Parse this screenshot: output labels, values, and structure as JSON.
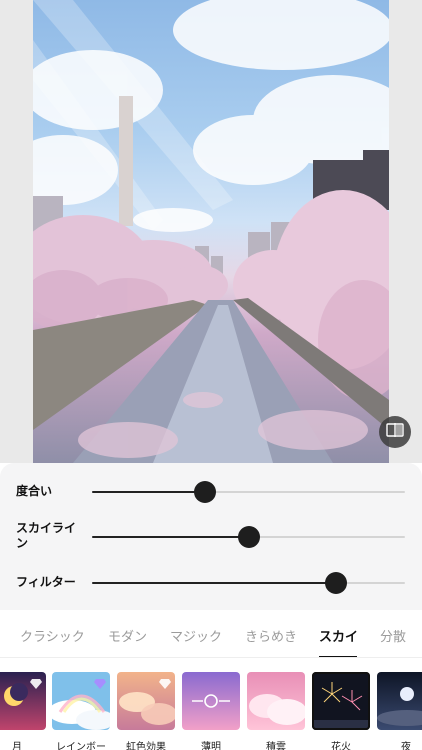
{
  "adjustments": [
    {
      "label": "度合い",
      "value": 0.36
    },
    {
      "label": "スカイライン",
      "value": 0.5
    },
    {
      "label": "フィルター",
      "value": 0.78
    }
  ],
  "tabs": [
    {
      "label": "クラシック"
    },
    {
      "label": "モダン"
    },
    {
      "label": "マジック"
    },
    {
      "label": "きらめき"
    },
    {
      "label": "スカイ"
    },
    {
      "label": "分散"
    }
  ],
  "active_tab": "スカイ",
  "filters": [
    {
      "label": "月",
      "premium": true
    },
    {
      "label": "レインボー",
      "premium": true
    },
    {
      "label": "虹色効果",
      "premium": true
    },
    {
      "label": "薄明",
      "premium": false
    },
    {
      "label": "積雲",
      "premium": false
    },
    {
      "label": "花火",
      "premium": false
    },
    {
      "label": "夜",
      "premium": false
    }
  ],
  "colors": {
    "accent": "#1e1e1e",
    "panel_bg": "#f5f5f6",
    "inactive_tab": "#9b9b9b"
  },
  "icons": {
    "compare": "compare-split-icon",
    "premium": "diamond-icon"
  }
}
